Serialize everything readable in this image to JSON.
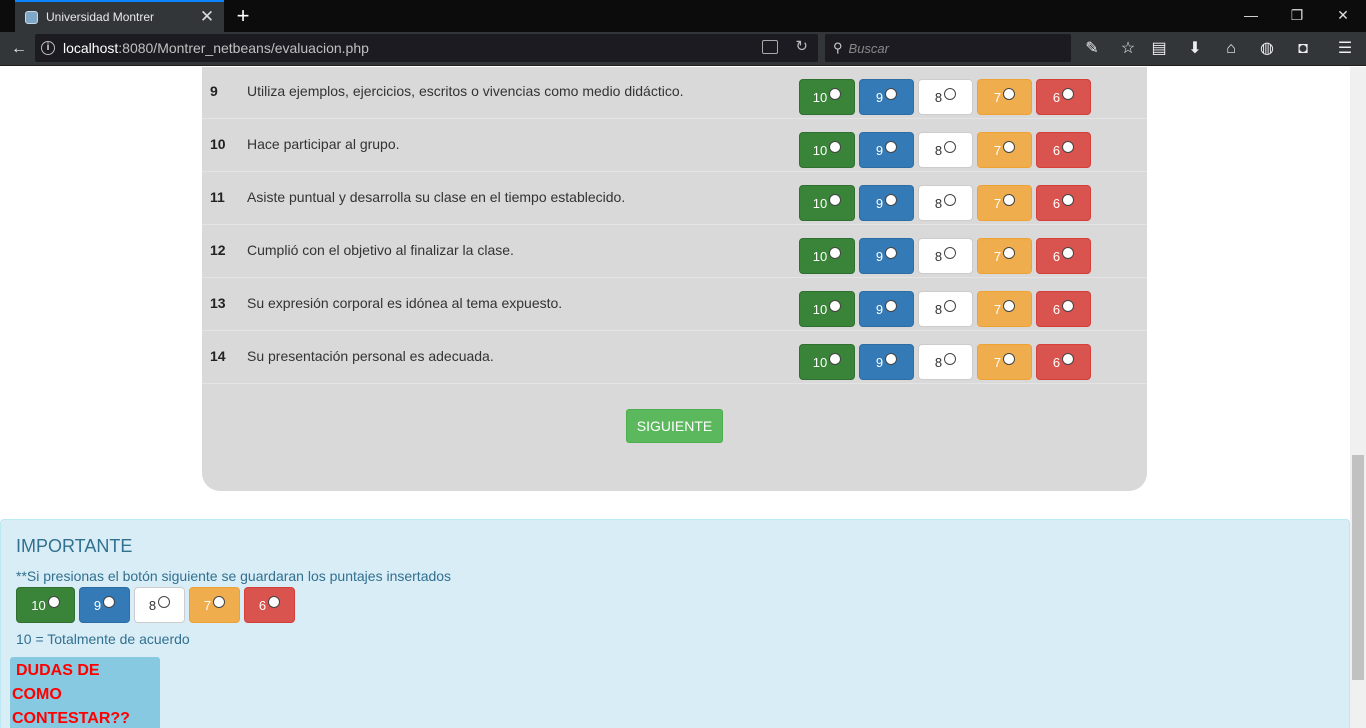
{
  "browser": {
    "tab_title": "Universidad Montrer",
    "tab_close": "✕",
    "new_tab": "+",
    "url_host": "localhost",
    "url_rest": ":8080/Montrer_netbeans/evaluacion.php",
    "search_placeholder": "Buscar",
    "window_controls": [
      "—",
      "❐",
      "✕"
    ]
  },
  "questions": [
    {
      "num": "9",
      "text": "Utiliza ejemplos, ejercicios, escritos o vivencias como medio didáctico."
    },
    {
      "num": "10",
      "text": "Hace participar al grupo."
    },
    {
      "num": "11",
      "text": "Asiste puntual y desarrolla su clase en el tiempo establecido."
    },
    {
      "num": "12",
      "text": "Cumplió con el objetivo al finalizar la clase."
    },
    {
      "num": "13",
      "text": "Su expresión corporal es idónea al tema expuesto."
    },
    {
      "num": "14",
      "text": "Su presentación personal es adecuada."
    }
  ],
  "score_options": [
    "10",
    "9",
    "8",
    "7",
    "6"
  ],
  "colors": {
    "option_10": "#398439",
    "option_9": "#337ab7",
    "option_8": "#ffffff",
    "option_7": "#f0ad4e",
    "option_6": "#d9534f",
    "next_button": "#5cb85c",
    "info_bg": "#d9edf7",
    "doubt_text": "#ff0000"
  },
  "next_label": "SIGUIENTE",
  "info": {
    "title": "IMPORTANTE",
    "note": "**Si presionas el botón siguiente se guardaran los puntajes insertados",
    "legend": "10 = Totalmente de acuerdo",
    "doubt_lines": [
      "DUDAS DE",
      "COMO",
      "CONTESTAR??"
    ]
  },
  "icons": [
    "back-arrow-icon",
    "info-icon",
    "reader-view-icon",
    "reload-icon",
    "search-icon",
    "wrench-icon",
    "star-icon",
    "library-icon",
    "download-icon",
    "home-icon",
    "globe-icon",
    "pocket-icon",
    "menu-icon"
  ]
}
